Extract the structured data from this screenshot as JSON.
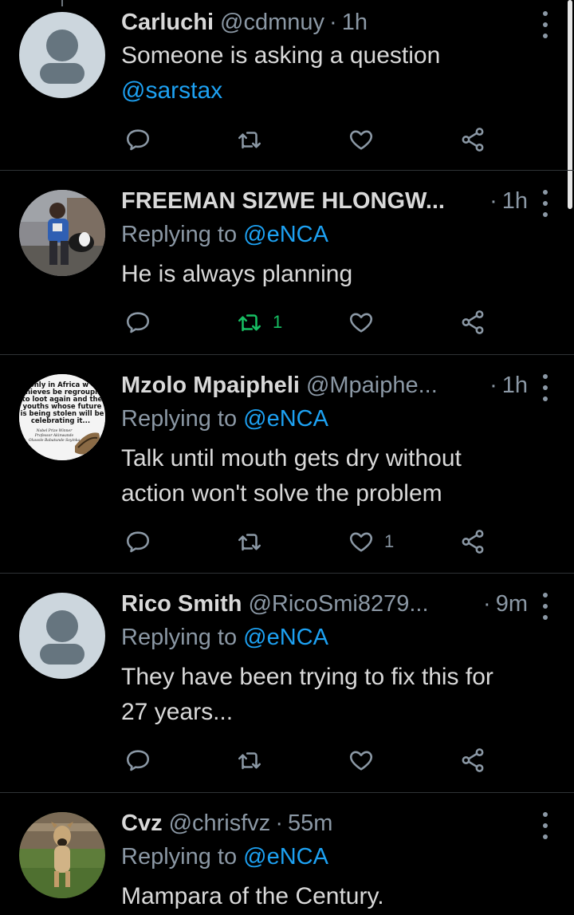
{
  "colors": {
    "background": "#000000",
    "text": "#d9d9d9",
    "muted": "#8b98a5",
    "link": "#1da1f2",
    "retweet_active": "#17bf63",
    "divider": "#2f3336"
  },
  "tweets": [
    {
      "name": "Carluchi",
      "handle": "@cdmnuy",
      "sep": "·",
      "time": "1h",
      "replying_prefix": "",
      "replying_to": "",
      "text_lines": [
        "Someone is asking a question"
      ],
      "mention_line": "@sarstax",
      "retweets": "",
      "likes": "",
      "avatar": "default-avatar"
    },
    {
      "name": "FREEMAN SIZWE HLONGW...",
      "handle": "",
      "sep": "·",
      "time": "1h",
      "replying_prefix": "Replying to ",
      "replying_to": "@eNCA",
      "text_lines": [
        "He is always planning"
      ],
      "retweets": "1",
      "likes": "",
      "avatar": "photo-man-with-dog"
    },
    {
      "name": "Mzolo Mpaipheli",
      "handle": "@Mpaiphe...",
      "sep": "·",
      "time": "1h",
      "replying_prefix": "Replying to ",
      "replying_to": "@eNCA",
      "text_lines": [
        "Talk until mouth gets dry without",
        "action won't solve the problem"
      ],
      "retweets": "",
      "likes": "1",
      "avatar": "quote-image",
      "avatar_text": [
        "only in Africa w",
        "thieves be regroupin",
        "to loot again and the",
        "youths whose future",
        "is being stolen will be",
        "celebrating it..."
      ],
      "avatar_attribution": [
        "Nobel Prize Winner",
        "Professor Akinwande",
        "Oluwole Babatunde Soyinka"
      ]
    },
    {
      "name": "Rico Smith",
      "handle": "@RicoSmi8279...",
      "sep": "·",
      "time": "9m",
      "replying_prefix": "Replying to ",
      "replying_to": "@eNCA",
      "text_lines": [
        "They have been trying to fix this for",
        "27 years..."
      ],
      "retweets": "",
      "likes": "",
      "avatar": "default-avatar"
    },
    {
      "name": "Cvz",
      "handle": "@chrisfvz",
      "sep": "·",
      "time": "55m",
      "replying_prefix": "Replying to ",
      "replying_to": "@eNCA",
      "text_lines": [
        "Mampara of the Century."
      ],
      "retweets": "",
      "likes": "",
      "avatar": "photo-dog"
    }
  ]
}
